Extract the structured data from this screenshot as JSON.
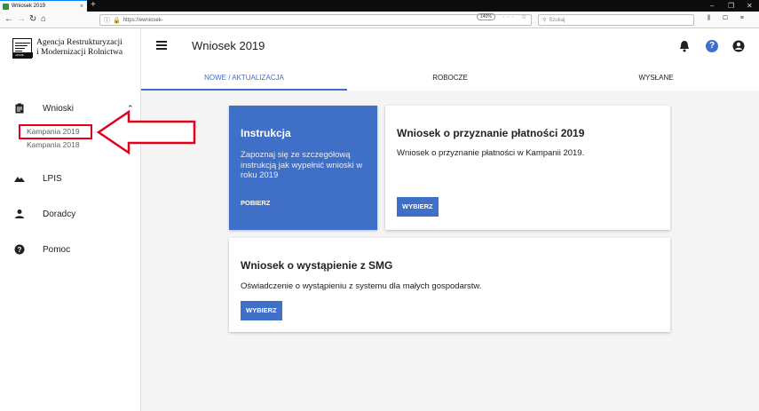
{
  "browser": {
    "tab_title": "Wniosek 2019",
    "tab_close": "×",
    "new_tab": "+",
    "url": "https://ewniosek-",
    "zoom": "140%",
    "search_placeholder": "Szukaj",
    "url_icons": "··· ☆",
    "toolbar_icons": "⫼ ▢ ≡",
    "window_controls": [
      "–",
      "❐",
      "✕"
    ],
    "nav": {
      "back": "←",
      "forward": "→",
      "reload": "↻",
      "home": "⌂"
    }
  },
  "logo": {
    "line1": "Agencja Restrukturyzacji",
    "line2": "i Modernizacji Rolnictwa",
    "mark": "ARiMR"
  },
  "sidebar": {
    "items": [
      {
        "label": "Wnioski",
        "icon": "clipboard-icon",
        "expanded": true
      },
      {
        "label": "LPIS",
        "icon": "mountains-icon"
      },
      {
        "label": "Doradcy",
        "icon": "person-icon"
      },
      {
        "label": "Pomoc",
        "icon": "help-circle-icon"
      }
    ],
    "subitems": [
      "Kampania 2019",
      "Kampania 2018"
    ],
    "chevron": "⌃"
  },
  "header": {
    "title": "Wniosek 2019",
    "tabs": [
      {
        "label": "NOWE / AKTUALIZACJA",
        "active": true
      },
      {
        "label": "ROBOCZE",
        "active": false
      },
      {
        "label": "WYSŁANE",
        "active": false
      }
    ]
  },
  "cards": {
    "instruction": {
      "title": "Instrukcja",
      "description": "Zapoznaj się ze szczegółową instrukcją jak wypełnić wnioski w roku 2019",
      "action": "POBIERZ"
    },
    "payment": {
      "title": "Wniosek o przyznanie płatności 2019",
      "description": "Wniosek o przyznanie płatności w Kampanii 2019.",
      "action": "WYBIERZ"
    },
    "smg": {
      "title": "Wniosek o wystąpienie z SMG",
      "description": "Oświadczenie o wystąpieniu z systemu dla małych gospodarstw.",
      "action": "WYBIERZ"
    }
  },
  "colors": {
    "primary": "#3f6fc7",
    "annotation": "#e2001a"
  }
}
